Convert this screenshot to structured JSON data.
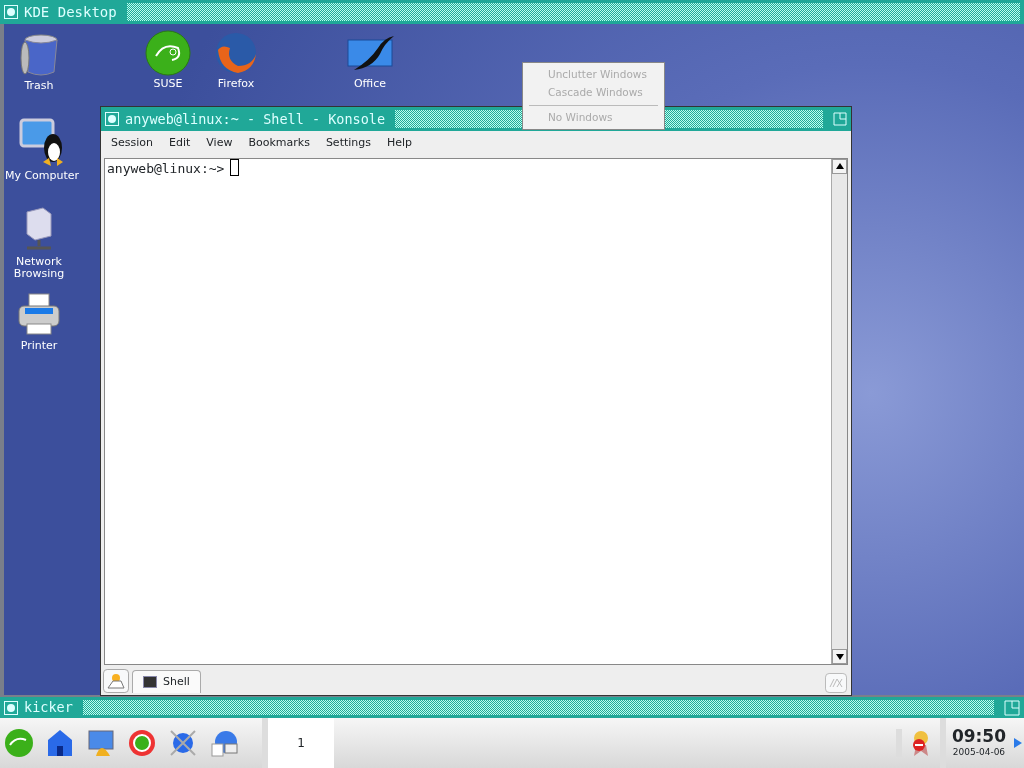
{
  "desktop_window": {
    "title": "KDE Desktop"
  },
  "desktop_icons": [
    {
      "label": "Trash"
    },
    {
      "label": "SUSE"
    },
    {
      "label": "Firefox"
    },
    {
      "label": "Office"
    },
    {
      "label": "My Computer"
    },
    {
      "label": "Network Browsing"
    },
    {
      "label": "Printer"
    }
  ],
  "window_menu": [
    {
      "label": "Unclutter Windows",
      "disabled": true
    },
    {
      "label": "Cascade Windows",
      "disabled": true
    },
    {
      "label": "No Windows",
      "disabled": true
    }
  ],
  "konsole": {
    "title": "anyweb@linux:~ - Shell - Konsole",
    "menu": [
      "Session",
      "Edit",
      "View",
      "Bookmarks",
      "Settings",
      "Help"
    ],
    "prompt": "anyweb@linux:~>",
    "tabs": [
      {
        "label": "Shell",
        "selected": true
      }
    ]
  },
  "kicker": {
    "title": "kicker",
    "pager": [
      {
        "label": "1",
        "selected": true
      }
    ],
    "clock": {
      "time": "09:50",
      "date": "2005-04-06"
    }
  }
}
